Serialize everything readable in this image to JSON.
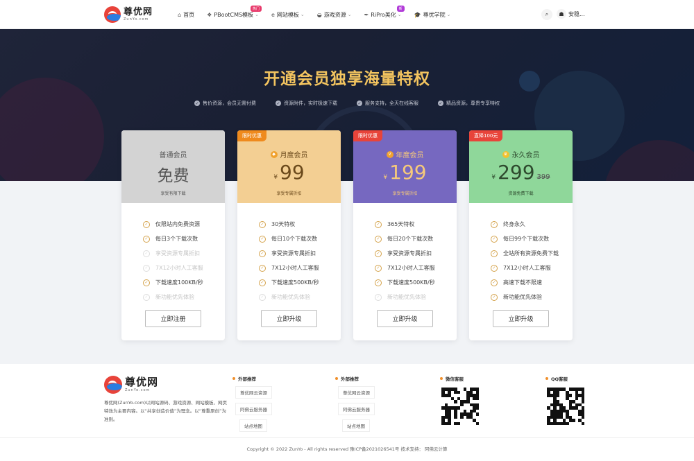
{
  "header": {
    "logo_name": "尊优网",
    "logo_sub": "ZunYo.com",
    "nav": [
      {
        "icon": "home-icon",
        "glyph": "⌂",
        "label": "首页",
        "chevron": false,
        "badge": ""
      },
      {
        "icon": "cube-icon",
        "glyph": "❖",
        "label": "PBootCMS模板",
        "chevron": true,
        "badge": "热门",
        "badge_color": "#e83a6b"
      },
      {
        "icon": "ie-icon",
        "glyph": "e",
        "label": "网站模板",
        "chevron": true,
        "badge": ""
      },
      {
        "icon": "gamepad-icon",
        "glyph": "◒",
        "label": "游戏资源",
        "chevron": true,
        "badge": ""
      },
      {
        "icon": "feather-icon",
        "glyph": "✒",
        "label": "RiPro美化",
        "chevron": true,
        "badge": "新",
        "badge_color": "#b13ad8"
      },
      {
        "icon": "graduation-cap-icon",
        "glyph": "🎓",
        "label": "尊优学院",
        "chevron": true,
        "badge": ""
      }
    ],
    "user_name": "安稳..."
  },
  "hero": {
    "title": "开通会员独享海量特权",
    "features": [
      "售价资源，会员无需付费",
      "资源附件，实时极速下载",
      "服务支持，全天在线客服",
      "精品资源，尊贵专享特权"
    ]
  },
  "cards": [
    {
      "tag": "",
      "name": "普通会员",
      "free_text": "免费",
      "currency": "",
      "price": "",
      "orig_price": "",
      "desc": "享受有限下载",
      "features": [
        {
          "text": "仅限站内免费资源",
          "enabled": true
        },
        {
          "text": "每日3个下载次数",
          "enabled": true
        },
        {
          "text": "享受资源专属折扣",
          "enabled": false
        },
        {
          "text": "7X12小时人工客服",
          "enabled": false
        },
        {
          "text": "下载速度100KB/秒",
          "enabled": true
        },
        {
          "text": "新功能优先体验",
          "enabled": false
        }
      ],
      "button": "立即注册",
      "colors": {
        "bg": "#d3d3d3",
        "text": "#555555",
        "tag": ""
      }
    },
    {
      "tag": "限时优惠",
      "name": "月度会员",
      "free_text": "",
      "currency": "¥",
      "price": "99",
      "orig_price": "",
      "desc": "享受专属折扣",
      "features": [
        {
          "text": "30天特权",
          "enabled": true
        },
        {
          "text": "每日10个下载次数",
          "enabled": true
        },
        {
          "text": "享受资源专属折扣",
          "enabled": true
        },
        {
          "text": "7X12小时人工客服",
          "enabled": true
        },
        {
          "text": "下载速度500KB/秒",
          "enabled": true
        },
        {
          "text": "新功能优先体验",
          "enabled": false
        }
      ],
      "button": "立即升级",
      "colors": {
        "bg": "#f3cf93",
        "text": "#6b4a1c",
        "tag": "#ef8a1d",
        "icon": "#f0a12e"
      }
    },
    {
      "tag": "限时优惠",
      "name": "年度会员",
      "free_text": "",
      "currency": "¥",
      "price": "199",
      "orig_price": "",
      "desc": "享受专属折扣",
      "features": [
        {
          "text": "365天特权",
          "enabled": true
        },
        {
          "text": "每日20个下载次数",
          "enabled": true
        },
        {
          "text": "享受资源专属折扣",
          "enabled": true
        },
        {
          "text": "7X12小时人工客服",
          "enabled": true
        },
        {
          "text": "下载速度500KB/秒",
          "enabled": true
        },
        {
          "text": "新功能优先体验",
          "enabled": false
        }
      ],
      "button": "立即升级",
      "colors": {
        "bg": "#7668c0",
        "text": "#f6c97a",
        "tag": "#e8443a",
        "icon": "#f0a12e"
      }
    },
    {
      "tag": "直降100元",
      "name": "永久会员",
      "free_text": "",
      "currency": "¥",
      "price": "299",
      "orig_price": "399",
      "desc": "资源免费下载",
      "features": [
        {
          "text": "终身永久",
          "enabled": true
        },
        {
          "text": "每日99个下载次数",
          "enabled": true
        },
        {
          "text": "全站所有资源免费下载",
          "enabled": true
        },
        {
          "text": "7X12小时人工客服",
          "enabled": true
        },
        {
          "text": "高速下载不限速",
          "enabled": true
        },
        {
          "text": "新功能优先体验",
          "enabled": true
        }
      ],
      "button": "立即升级",
      "colors": {
        "bg": "#8fd79a",
        "text": "#2e4a2e",
        "tag": "#e8443a",
        "icon": "#f0c12e"
      }
    }
  ],
  "footer": {
    "logo_name": "尊优网",
    "logo_sub": "ZunYo.com",
    "about": "尊优网(ZunYo.com)以网站源码、游戏资源、网站模板、网页特效为主要内容。以“共享创造价值”为理念。以“尊重原创”为准则。",
    "col1": {
      "title": "外部推荐",
      "links": [
        "尊优网云资源",
        "阿佛云服务器",
        "站点地图"
      ]
    },
    "col2": {
      "title": "外部推荐",
      "links": [
        "尊优网云资源",
        "阿佛云服务器",
        "站点地图"
      ]
    },
    "wechat_title": "微信客服",
    "qq_title": "QQ客服",
    "copyright": "Copyright © 2022  ZunYo  - All rights reserved 豫ICP备2021026541号  技术支持：  阿佛云计算"
  }
}
